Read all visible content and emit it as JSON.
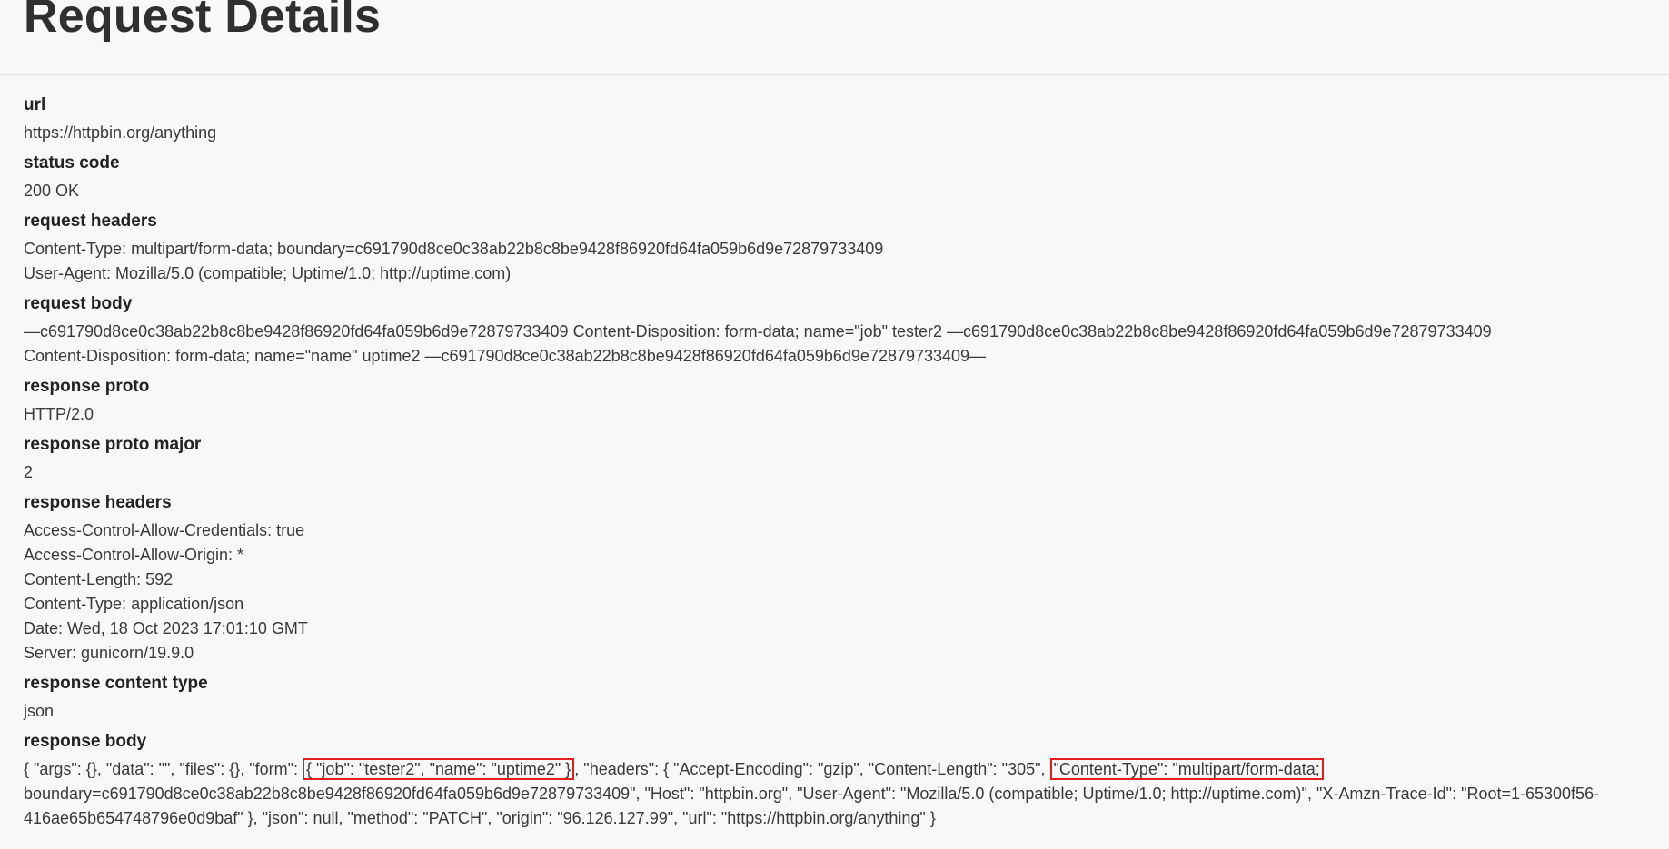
{
  "page": {
    "title": "Request Details"
  },
  "fields": {
    "url": {
      "label": "url",
      "value": "https://httpbin.org/anything"
    },
    "status_code": {
      "label": "status code",
      "value": "200 OK"
    },
    "request_headers": {
      "label": "request headers",
      "lines": [
        "Content-Type: multipart/form-data; boundary=c691790d8ce0c38ab22b8c8be9428f86920fd64fa059b6d9e72879733409",
        "User-Agent: Mozilla/5.0 (compatible; Uptime/1.0; http://uptime.com)"
      ]
    },
    "request_body": {
      "label": "request body",
      "lines": [
        "—c691790d8ce0c38ab22b8c8be9428f86920fd64fa059b6d9e72879733409 Content-Disposition: form-data; name=\"job\" tester2 —c691790d8ce0c38ab22b8c8be9428f86920fd64fa059b6d9e72879733409",
        "Content-Disposition: form-data; name=\"name\" uptime2 —c691790d8ce0c38ab22b8c8be9428f86920fd64fa059b6d9e72879733409—"
      ]
    },
    "response_proto": {
      "label": "response proto",
      "value": "HTTP/2.0"
    },
    "response_proto_major": {
      "label": "response proto major",
      "value": "2"
    },
    "response_headers": {
      "label": "response headers",
      "lines": [
        "Access-Control-Allow-Credentials: true",
        "Access-Control-Allow-Origin: *",
        "Content-Length: 592",
        "Content-Type: application/json",
        "Date: Wed, 18 Oct 2023 17:01:10 GMT",
        "Server: gunicorn/19.9.0"
      ]
    },
    "response_content_type": {
      "label": "response content type",
      "value": "json"
    },
    "response_body": {
      "label": "response body",
      "part1": "{ \"args\": {}, \"data\": \"\", \"files\": {}, \"form\": ",
      "highlight1": "{ \"job\": \"tester2\", \"name\": \"uptime2\" }",
      "part2": ", \"headers\": { \"Accept-Encoding\": \"gzip\", \"Content-Length\": \"305\", ",
      "highlight2": "\"Content-Type\": \"multipart/form-data;",
      "part3": " boundary=c691790d8ce0c38ab22b8c8be9428f86920fd64fa059b6d9e72879733409\", \"Host\": \"httpbin.org\", \"User-Agent\": \"Mozilla/5.0 (compatible; Uptime/1.0; http://uptime.com)\", \"X-Amzn-Trace-Id\": \"Root=1-65300f56-416ae65b654748796e0d9baf\" }, \"json\": null, \"method\": \"PATCH\", \"origin\": \"96.126.127.99\", \"url\": \"https://httpbin.org/anything\" }"
    }
  },
  "colors": {
    "highlight_border": "#e01e1e",
    "background": "#f8f8f8"
  }
}
